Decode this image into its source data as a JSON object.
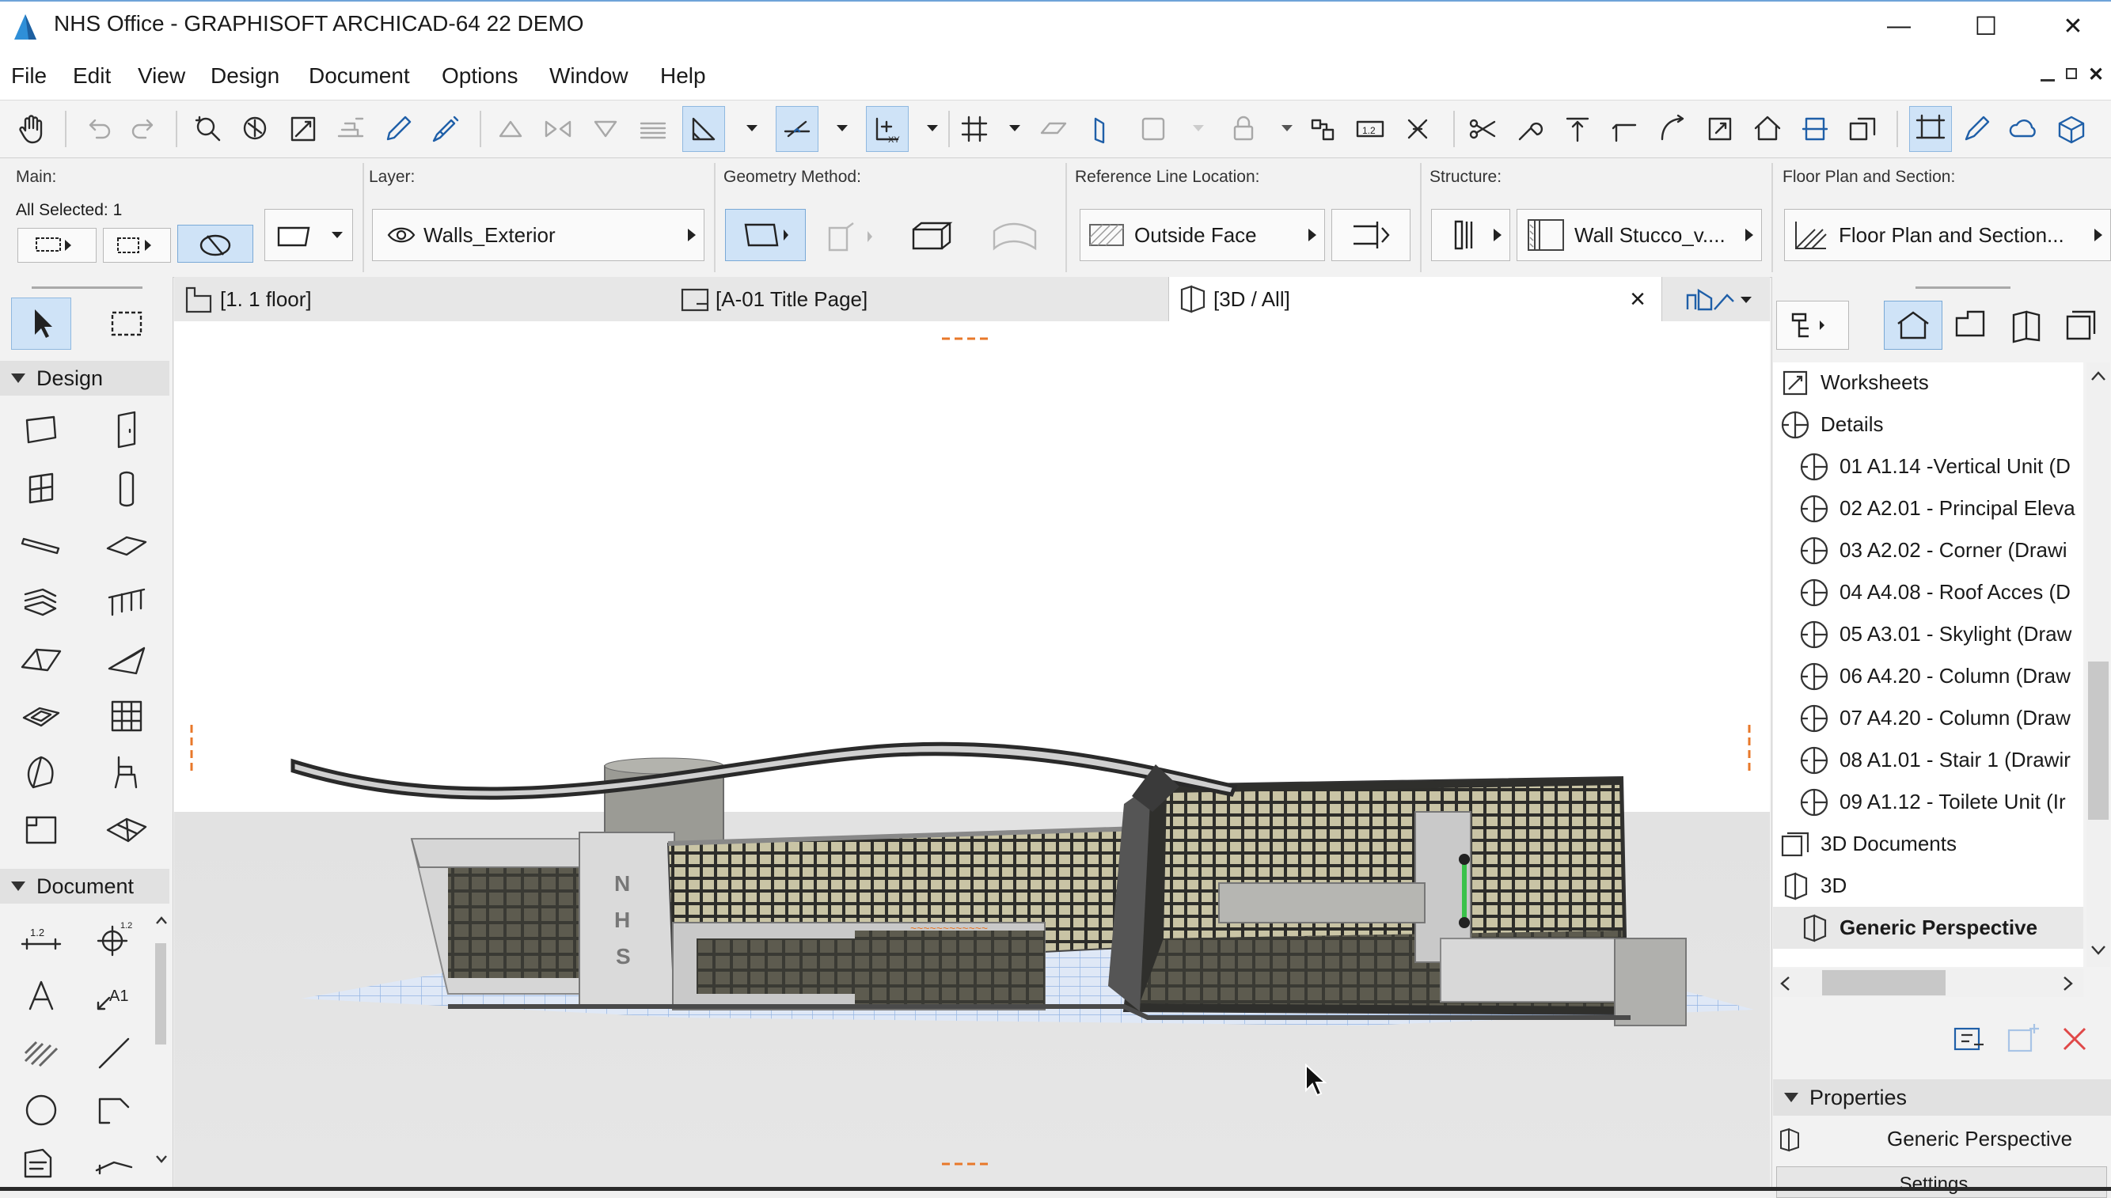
{
  "window": {
    "title": "NHS Office - GRAPHISOFT ARCHICAD-64 22 DEMO",
    "minimize_glyph": "—",
    "maximize_glyph": "☐",
    "close_glyph": "✕"
  },
  "menu": {
    "items": [
      "File",
      "Edit",
      "View",
      "Design",
      "Document",
      "Options",
      "Window",
      "Help"
    ]
  },
  "infobox": {
    "main_label": "Main:",
    "main_selected": "All Selected: 1",
    "layer_label": "Layer:",
    "layer_value": "Walls_Exterior",
    "geometry_label": "Geometry Method:",
    "refline_label": "Reference Line Location:",
    "refline_value": "Outside Face",
    "structure_label": "Structure:",
    "structure_value": "Wall Stucco_v....",
    "floorplan_label": "Floor Plan and Section:",
    "floorplan_value": "Floor Plan and Section..."
  },
  "toolbox": {
    "design_header": "Design",
    "document_header": "Document"
  },
  "tabs": [
    {
      "label": "[1. 1 floor]"
    },
    {
      "label": "[A-01 Title Page]"
    },
    {
      "label": "[3D / All]"
    }
  ],
  "tab_close_glyph": "×",
  "viewport": {
    "building_letters": [
      "N",
      "H",
      "S"
    ],
    "cursor_icon": "arrow-cursor-icon"
  },
  "navigator": {
    "items": [
      {
        "label": "Worksheets",
        "icon": "worksheet-icon",
        "level": 0
      },
      {
        "label": "Details",
        "icon": "detail-icon",
        "level": 0
      },
      {
        "label": "01 A1.14 -Vertical Unit (D",
        "icon": "detail-icon",
        "level": 1
      },
      {
        "label": "02 A2.01 - Principal Eleva",
        "icon": "detail-icon",
        "level": 1
      },
      {
        "label": "03 A2.02 - Corner (Drawi",
        "icon": "detail-icon",
        "level": 1
      },
      {
        "label": "04 A4.08 - Roof Acces (D",
        "icon": "detail-icon",
        "level": 1
      },
      {
        "label": "05 A3.01 - Skylight (Draw",
        "icon": "detail-icon",
        "level": 1
      },
      {
        "label": "06 A4.20 - Column (Draw",
        "icon": "detail-icon",
        "level": 1
      },
      {
        "label": "07 A4.20 - Column (Draw",
        "icon": "detail-icon",
        "level": 1
      },
      {
        "label": "08 A1.01 - Stair 1 (Drawir",
        "icon": "detail-icon",
        "level": 1
      },
      {
        "label": "09 A1.12 - Toilete Unit (Ir",
        "icon": "detail-icon",
        "level": 1
      },
      {
        "label": "3D Documents",
        "icon": "3d-document-icon",
        "level": 0
      },
      {
        "label": "3D",
        "icon": "3d-view-icon",
        "level": 0
      },
      {
        "label": "Generic Perspective",
        "icon": "3d-view-icon",
        "level": 1,
        "selected": true
      }
    ],
    "properties_header": "Properties",
    "properties_value": "Generic Perspective",
    "settings_label": "Settings..."
  },
  "colors": {
    "accent": "#cfe3f7",
    "selection_blue": "#1f5fa8",
    "annotation_orange": "#e8782a",
    "delete_red": "#e04848"
  }
}
